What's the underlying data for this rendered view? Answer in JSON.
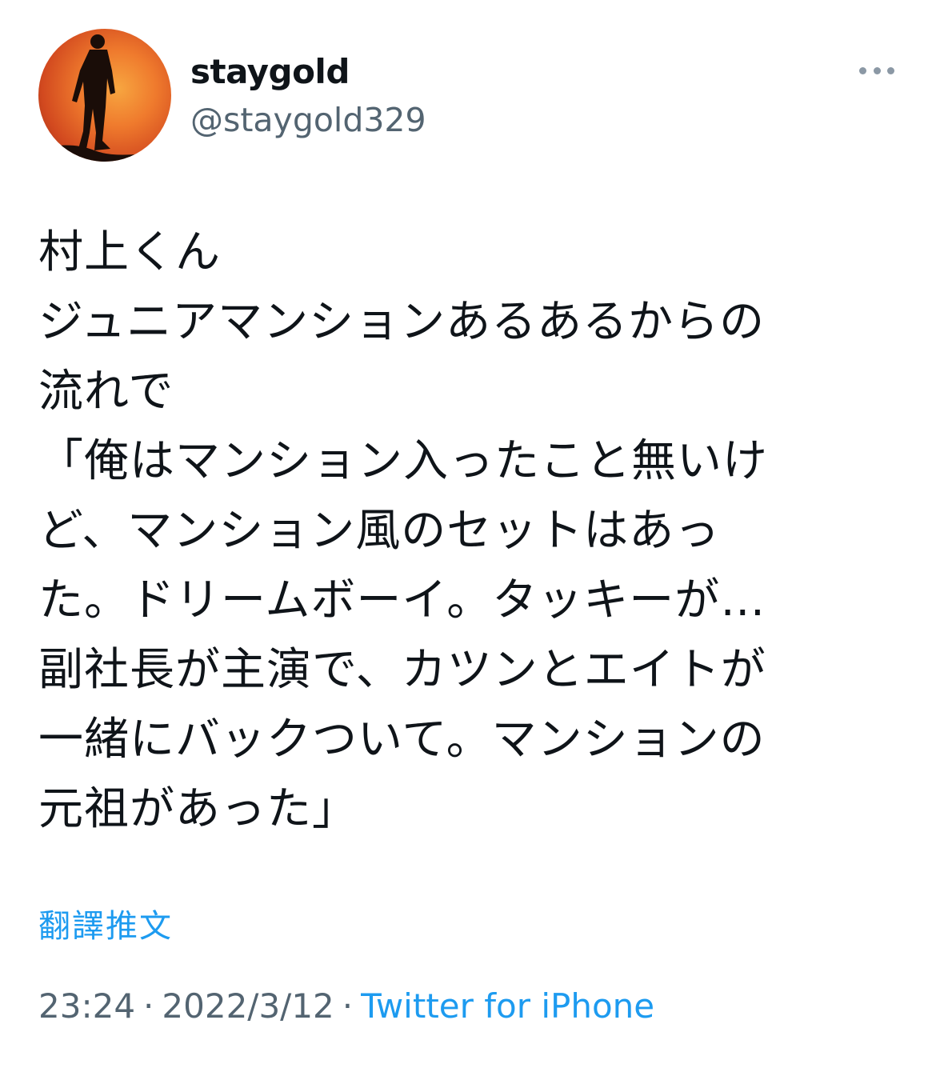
{
  "user": {
    "display_name": "staygold",
    "handle": "@staygold329"
  },
  "tweet": {
    "text": "村上くん\nジュニアマンションあるあるからの\n流れで\n「俺はマンション入ったこと無いけ\nど、マンション風のセットはあっ\nた。ドリームボーイ。タッキーが…\n副社長が主演で、カツンとエイトが\n一緒にバックついて。マンションの\n元祖があった」"
  },
  "translate_label": "翻譯推文",
  "meta": {
    "time": "23:24",
    "date": "2022/3/12",
    "separator": "·",
    "source": "Twitter for iPhone"
  },
  "colors": {
    "link": "#1d9bf0",
    "secondary_text": "#536471",
    "primary_text": "#0f1419"
  },
  "icons": {
    "more": "more-horizontal-icon",
    "avatar": "silhouette-sunset-avatar"
  }
}
